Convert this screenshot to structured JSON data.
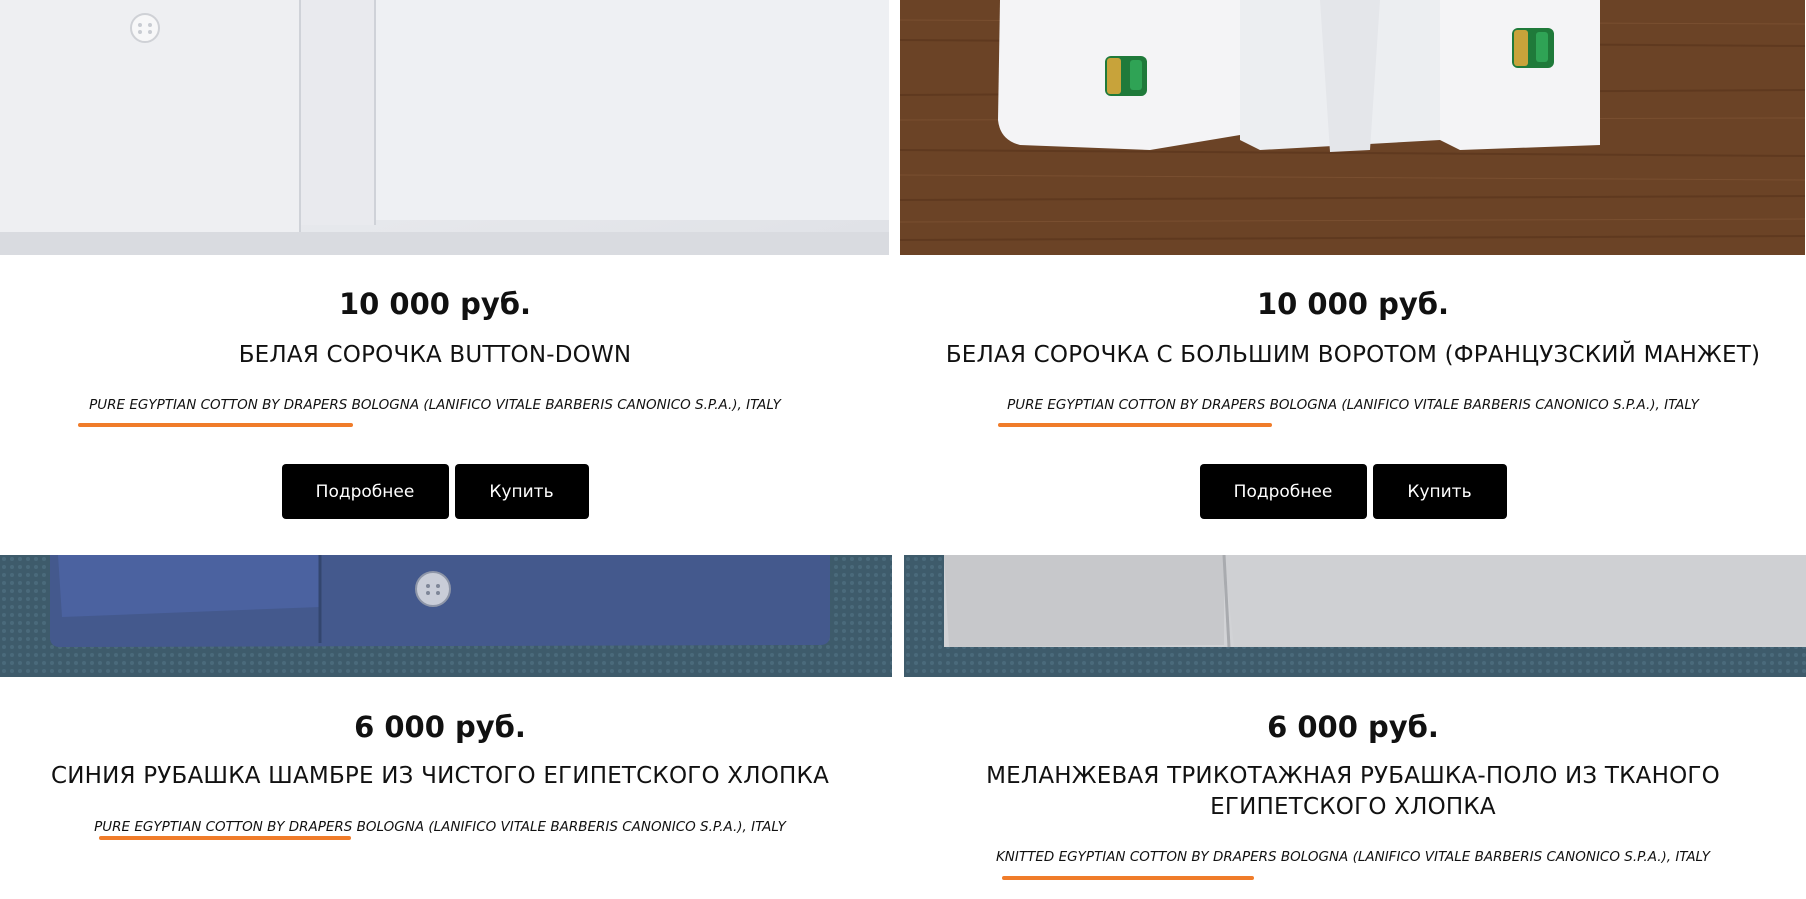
{
  "products": [
    {
      "price": "10 000 руб.",
      "title": "БЕЛАЯ СОРОЧКА BUTTON-DOWN",
      "fabric": "PURE EGYPTIAN COTTON BY DRAPERS BOLOGNA (LANIFICO VITALE BARBERIS CANONICO S.P.A.), ITALY",
      "more_label": "Подробнее",
      "buy_label": "Купить"
    },
    {
      "price": "10 000 руб.",
      "title": "БЕЛАЯ СОРОЧКА С БОЛЬШИМ ВОРОТОМ (ФРАНЦУЗСКИЙ МАНЖЕТ)",
      "fabric": "PURE EGYPTIAN COTTON BY DRAPERS BOLOGNA (LANIFICO VITALE BARBERIS CANONICO S.P.A.), ITALY",
      "more_label": "Подробнее",
      "buy_label": "Купить"
    },
    {
      "price": "6 000 руб.",
      "title": "СИНИЯ РУБАШКА ШАМБРЕ ИЗ ЧИСТОГО ЕГИПЕТСКОГО ХЛОПКА",
      "fabric": "PURE EGYPTIAN COTTON BY DRAPERS BOLOGNA (LANIFICO VITALE BARBERIS CANONICO S.P.A.), ITALY"
    },
    {
      "price": "6 000 руб.",
      "title": "МЕЛАНЖЕВАЯ ТРИКОТАЖНАЯ РУБАШКА-ПОЛО ИЗ ТКАНОГО ЕГИПЕТСКОГО ХЛОПКА",
      "fabric": "KNITTED EGYPTIAN COTTON BY DRAPERS BOLOGNA (LANIFICO VITALE BARBERIS CANONICO S.P.A.), ITALY"
    }
  ],
  "colors": {
    "accent_underline": "#f07c2a",
    "button_bg": "#000000",
    "button_text": "#ffffff"
  }
}
